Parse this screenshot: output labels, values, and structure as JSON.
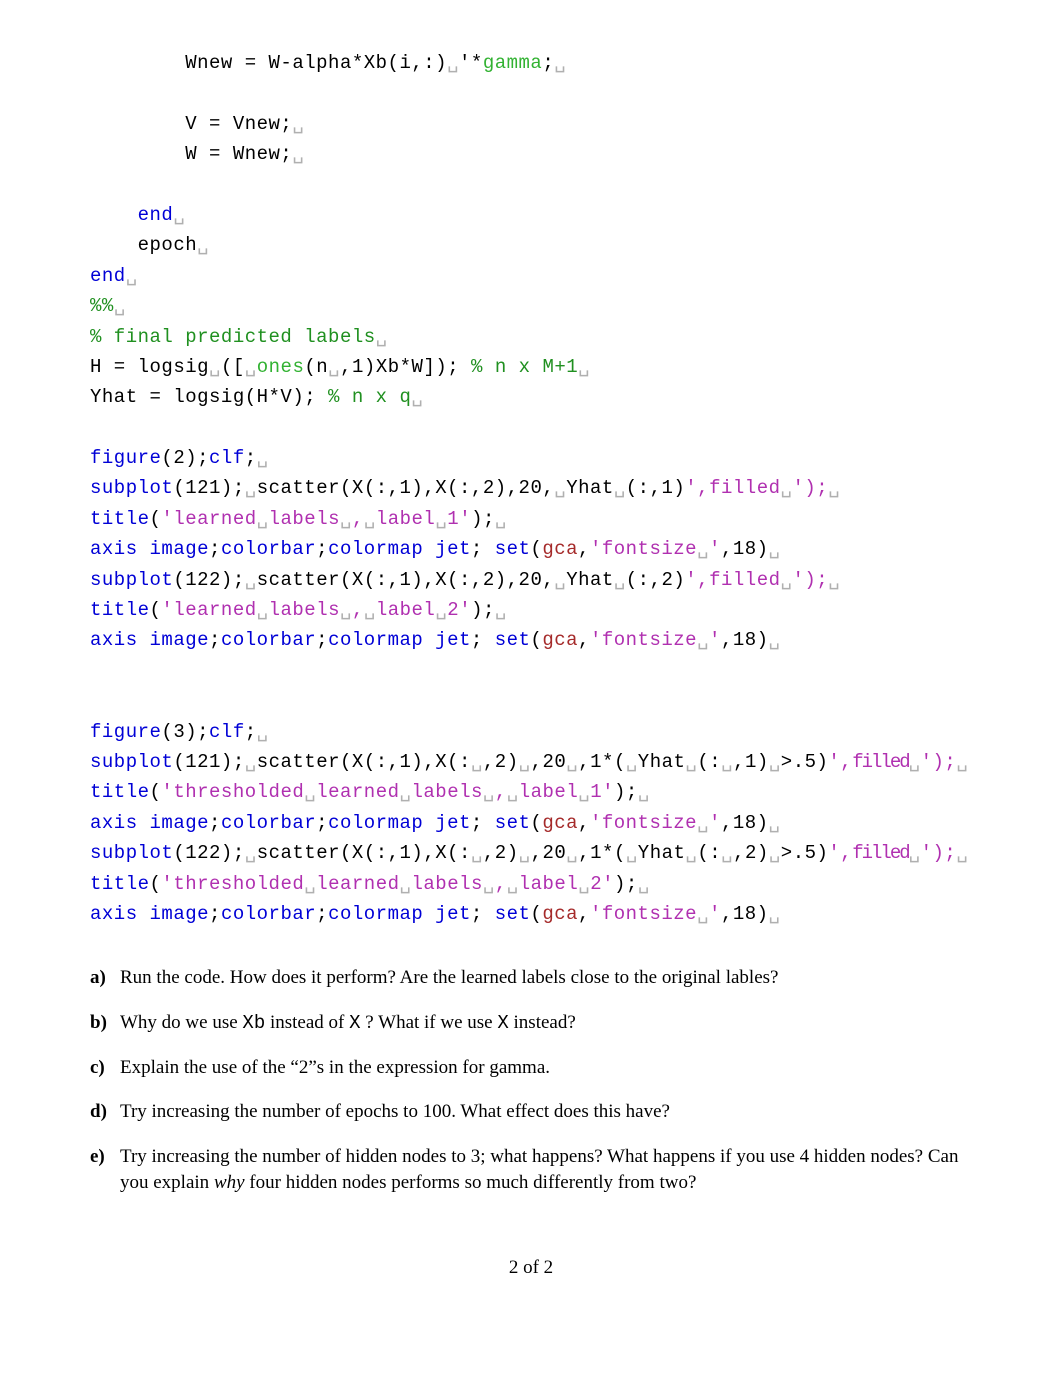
{
  "code": {
    "l1": "Wnew = W-alpha*Xb(i,:)",
    "l1b": "'*",
    "l1c": "gamma",
    "l1d": ";",
    "l2": "V = Vnew;",
    "l3": "W = Wnew;",
    "l4": "end",
    "l5": "epoch",
    "l6": "end",
    "l7": "%%",
    "l8": "% final predicted labels",
    "l9a": "H = logsig",
    "l9b": "([",
    "l9c": "ones",
    "l9d": "(n",
    "l9e": ",1)Xb*W]); ",
    "l9f": "% n x M+1",
    "l10a": "Yhat = logsig(H*V); ",
    "l10b": "% n x q",
    "f2": "figure",
    "clf": "clf",
    "subplot": "subplot",
    "title": "title",
    "axisimage": "axis image",
    "colorbar": "colorbar",
    "colormapjet": "colormap jet",
    "set": "set",
    "gca": "gca",
    "l11": "(2);",
    "l12a": "(121);",
    "l12b": "scatter(X(:,1),X(:,2),20,",
    "l12c": "Yhat",
    "l12d": "(:,1)",
    "l12e": "',",
    "l12f": "filled",
    "l12g": "');",
    "l13a": "(",
    "l13s": "'learned",
    "l13s2": "labels",
    "l13s3": ",",
    "l13s4": "label",
    "l13s5": "1'",
    "l13b": ");",
    "l14a": "; ",
    "l14b": "(",
    "l14c": ",",
    "l14d": "'fontsize",
    "l14e": "'",
    "l14f": ",18)",
    "l15a": "(122);",
    "l15b": "scatter(X(:,1),X(:,2),20,",
    "l15c": "Yhat",
    "l15d": "(:,2)",
    "l15e": "',",
    "l15f": "filled",
    "l15g": "');",
    "l16s5": "2'",
    "f3": "(3);",
    "l18a": "(121);",
    "l18b": "scatter(X(:,1),X(:",
    "l18c": ",2)",
    "l18d": ",20",
    "l18e": ",1*(",
    "l18f": "Yhat",
    "l18g": "(:",
    "l18h": ",1)",
    "l18i": ">.5)",
    "l18j": "',",
    "l18k": "filled",
    "l18l": "');",
    "l19s": "'thresholded",
    "l19s2": "learned",
    "l19s3": "labels",
    "l19s4": ",",
    "l19s5": "label",
    "l19s6": "1'",
    "l20a": "(122);",
    "l20b": "scatter(X(:,1),X(:",
    "l20c": ",2)",
    "l20d": ",20",
    "l20e": ",1*(",
    "l20f": "Yhat",
    "l20g": "(:",
    "l20h": ",2)",
    "l20i": ">.5)",
    "l20j": "',",
    "l20k": "filled",
    "l20l": "');",
    "l21s6": "2'"
  },
  "questions": {
    "a": {
      "letter": "a)",
      "text": "Run the code. How does it perform? Are the learned labels close to the original lables?"
    },
    "b": {
      "letter": "b)",
      "pre": "Why do we use ",
      "tt1": "Xb",
      "mid": " instead of ",
      "tt2": "X",
      "mid2": " ? What if we use ",
      "tt3": "X",
      "post": " instead?"
    },
    "c": {
      "letter": "c)",
      "text": "Explain the use of the “2”s in the expression for gamma."
    },
    "d": {
      "letter": "d)",
      "text": "Try increasing the number of epochs to 100. What effect does this have?"
    },
    "e": {
      "letter": "e)",
      "pre": "Try increasing the number of hidden nodes to 3; what happens? What happens if you use 4 hidden nodes? Can you explain ",
      "it": "why",
      "post": " four hidden nodes performs so much differently from two?"
    }
  },
  "pagenum": "2 of 2"
}
